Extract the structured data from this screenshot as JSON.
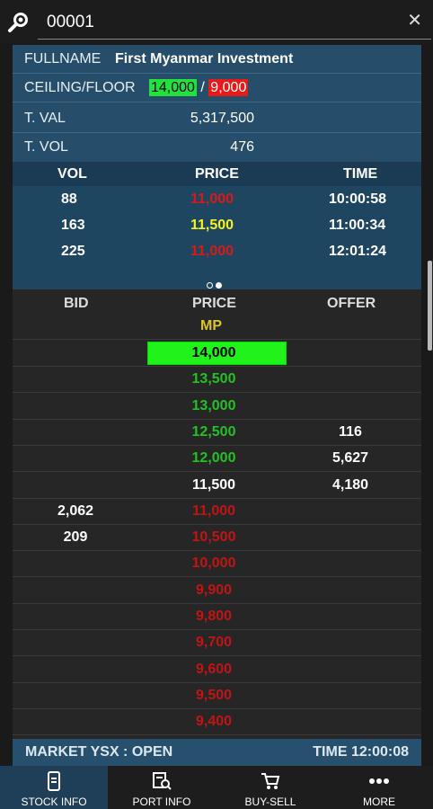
{
  "search": {
    "value": "00001"
  },
  "info": {
    "fullname_label": "FULLNAME",
    "fullname": "First Myanmar Investment",
    "ceilfloor_label": "CEILING/FLOOR",
    "ceiling": "14,000",
    "slash": "/",
    "floor": "9,000",
    "tval_label": "T. VAL",
    "tval": "5,317,500",
    "tvol_label": "T. VOL",
    "tvol": "476"
  },
  "trades": {
    "headers": {
      "vol": "VOL",
      "price": "PRICE",
      "time": "TIME"
    },
    "rows": [
      {
        "vol": "88",
        "price": "11,000",
        "time": "10:00:58",
        "color": "#d61a1a"
      },
      {
        "vol": "163",
        "price": "11,500",
        "time": "11:00:34",
        "color": "#f2f222"
      },
      {
        "vol": "225",
        "price": "11,000",
        "time": "12:01:24",
        "color": "#d61a1a"
      }
    ]
  },
  "book": {
    "headers": {
      "bid": "BID",
      "price": "PRICE",
      "offer": "OFFER"
    },
    "mp": "MP",
    "rows": [
      {
        "bid": "",
        "price": "14,000",
        "offer": "",
        "color": "#000000"
      },
      {
        "bid": "",
        "price": "13,500",
        "offer": "",
        "color": "#25c025"
      },
      {
        "bid": "",
        "price": "13,000",
        "offer": "",
        "color": "#25c025"
      },
      {
        "bid": "",
        "price": "12,500",
        "offer": "116",
        "color": "#25c025"
      },
      {
        "bid": "",
        "price": "12,000",
        "offer": "5,627",
        "color": "#25c025"
      },
      {
        "bid": "",
        "price": "11,500",
        "offer": "4,180",
        "color": "#ffffff"
      },
      {
        "bid": "2,062",
        "price": "11,000",
        "offer": "",
        "color": "#c21414"
      },
      {
        "bid": "209",
        "price": "10,500",
        "offer": "",
        "color": "#c21414"
      },
      {
        "bid": "",
        "price": "10,000",
        "offer": "",
        "color": "#c21414"
      },
      {
        "bid": "",
        "price": "9,900",
        "offer": "",
        "color": "#c21414"
      },
      {
        "bid": "",
        "price": "9,800",
        "offer": "",
        "color": "#c21414"
      },
      {
        "bid": "",
        "price": "9,700",
        "offer": "",
        "color": "#c21414"
      },
      {
        "bid": "",
        "price": "9,600",
        "offer": "",
        "color": "#c21414"
      },
      {
        "bid": "",
        "price": "9,500",
        "offer": "",
        "color": "#c21414"
      },
      {
        "bid": "",
        "price": "9,400",
        "offer": "",
        "color": "#c21414"
      }
    ]
  },
  "status": {
    "market": "MARKET YSX : OPEN",
    "time": "TIME 12:00:08"
  },
  "nav": [
    {
      "label": "STOCK INFO",
      "icon": "stock-info-icon"
    },
    {
      "label": "PORT INFO",
      "icon": "port-info-icon"
    },
    {
      "label": "BUY-SELL",
      "icon": "cart-icon"
    },
    {
      "label": "MORE",
      "icon": "more-icon"
    }
  ],
  "colors": {
    "panel": "#264e6a",
    "accent_green": "#21f21c",
    "down_red": "#c21414",
    "up_green": "#25c025",
    "unchanged_yellow": "#f2f222"
  }
}
